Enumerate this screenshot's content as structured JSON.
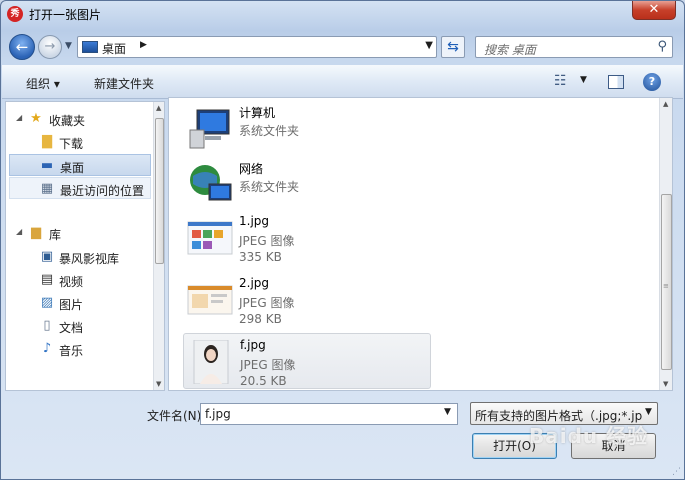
{
  "window": {
    "title": "打开一张图片",
    "app_icon_glyph": "秀",
    "close_glyph": "✕"
  },
  "address": {
    "location": "桌面",
    "search_placeholder": "搜索 桌面"
  },
  "toolbar": {
    "organize_label": "组织 ▾",
    "new_folder_label": "新建文件夹",
    "help_glyph": "?"
  },
  "nav": {
    "items": [
      {
        "label": "收藏夹",
        "icon": "star-icon"
      },
      {
        "label": "下载",
        "icon": "download-folder-icon"
      },
      {
        "label": "桌面",
        "icon": "desktop-icon"
      },
      {
        "label": "最近访问的位置",
        "icon": "recent-places-icon"
      },
      {
        "label": "库",
        "icon": "library-icon"
      },
      {
        "label": "暴风影视库",
        "icon": "video-library-icon"
      },
      {
        "label": "视频",
        "icon": "video-icon"
      },
      {
        "label": "图片",
        "icon": "pictures-icon"
      },
      {
        "label": "文档",
        "icon": "documents-icon"
      },
      {
        "label": "音乐",
        "icon": "music-icon"
      }
    ],
    "selected": "桌面"
  },
  "files": [
    {
      "name": "计算机",
      "type": "系统文件夹",
      "size": "",
      "icon": "computer-icon"
    },
    {
      "name": "网络",
      "type": "系统文件夹",
      "size": "",
      "icon": "network-icon"
    },
    {
      "name": "1.jpg",
      "type": "JPEG 图像",
      "size": "335 KB",
      "icon": "image-thumbnail"
    },
    {
      "name": "2.jpg",
      "type": "JPEG 图像",
      "size": "298 KB",
      "icon": "image-thumbnail"
    },
    {
      "name": "f.jpg",
      "type": "JPEG 图像",
      "size": "20.5 KB",
      "icon": "image-thumbnail"
    }
  ],
  "bottom": {
    "filename_label": "文件名(N):",
    "filename_value": "f.jpg",
    "filter_value": "所有支持的图片格式（.jpg;*.jp",
    "open_label": "打开(O)",
    "cancel_label": "取消"
  },
  "watermark": "Baidu 经验",
  "colors": {
    "selection": "#c8d8ed",
    "close_button": "#c7402a",
    "link_blue": "#1f5fb8"
  }
}
